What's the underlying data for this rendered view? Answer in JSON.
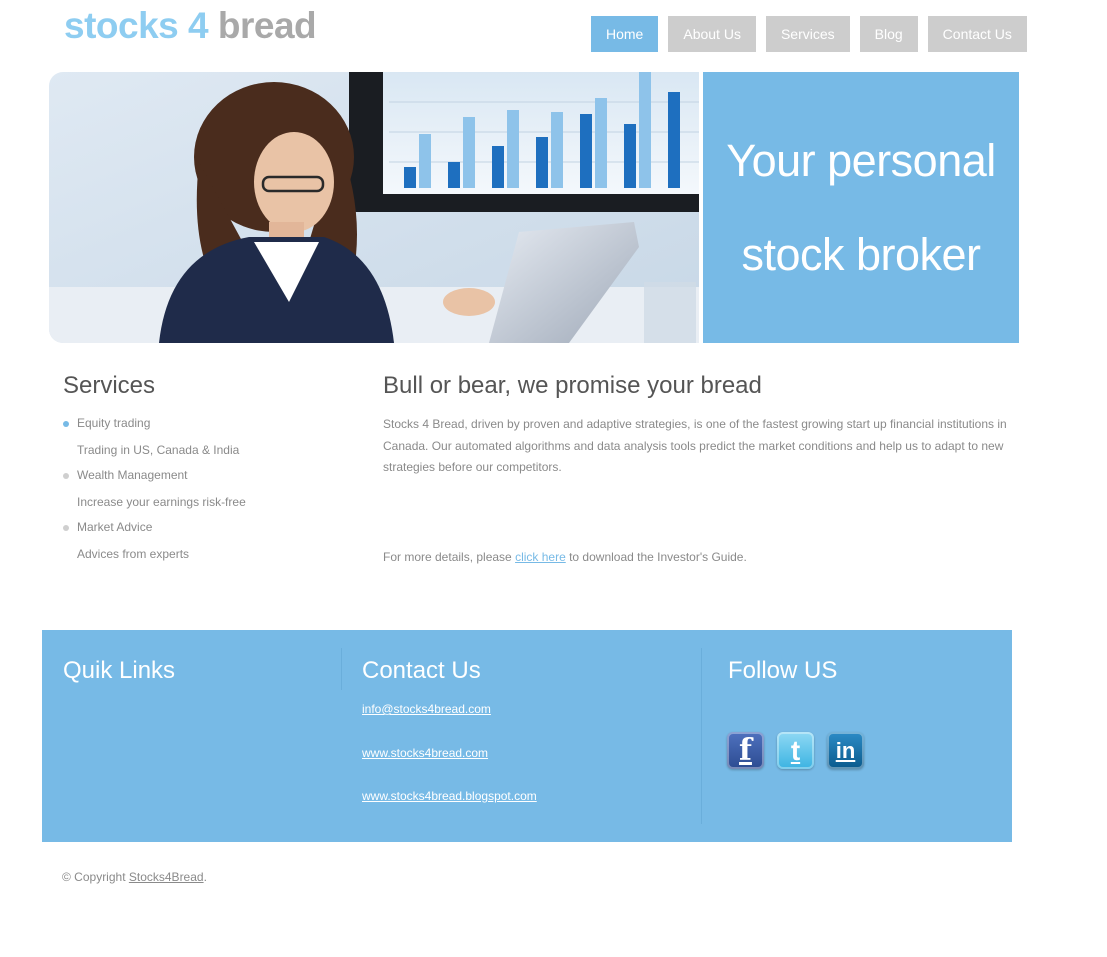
{
  "logo": {
    "part1": "stocks 4",
    "part2": "bread"
  },
  "nav": {
    "items": [
      "Home",
      "About Us",
      "Services",
      "Blog",
      "Contact Us"
    ],
    "active": "Home"
  },
  "hero": {
    "line1": "Your personal",
    "line2": "stock broker"
  },
  "services": {
    "title": "Services",
    "items": [
      {
        "title": "Equity trading",
        "desc": "Trading in US, Canada & India"
      },
      {
        "title": "Wealth Management",
        "desc": "Increase your earnings risk-free"
      },
      {
        "title": "Market Advice",
        "desc": "Advices from experts"
      }
    ]
  },
  "main": {
    "heading": "Bull or bear, we promise your bread",
    "body": "Stocks 4 Bread, driven by proven and adaptive strategies, is one of the fastest growing start up financial institutions in Canada. Our automated algorithms and data analysis tools predict the market conditions and help us to adapt to new strategies before our competitors.",
    "more_prefix": "For more details, please ",
    "more_link": "click here",
    "more_suffix": " to download the Investor's Guide."
  },
  "footer": {
    "quick_links_title": "Quik Links",
    "contact_title": "Contact Us",
    "contact_lines": [
      "info@stocks4bread.com",
      "www.stocks4bread.com",
      "www.stocks4bread.blogspot.com"
    ],
    "follow_title": "Follow US",
    "social": {
      "facebook": "f",
      "twitter": "t",
      "linkedin": "in"
    }
  },
  "copyright": {
    "prefix": "© Copyright ",
    "link": "Stocks4Bread",
    "suffix": "."
  },
  "colors": {
    "accent": "#77bae6",
    "nav_inactive": "#cdcdcd",
    "logo_blue": "#8ecdf1",
    "logo_gray": "#a9a9a9"
  }
}
